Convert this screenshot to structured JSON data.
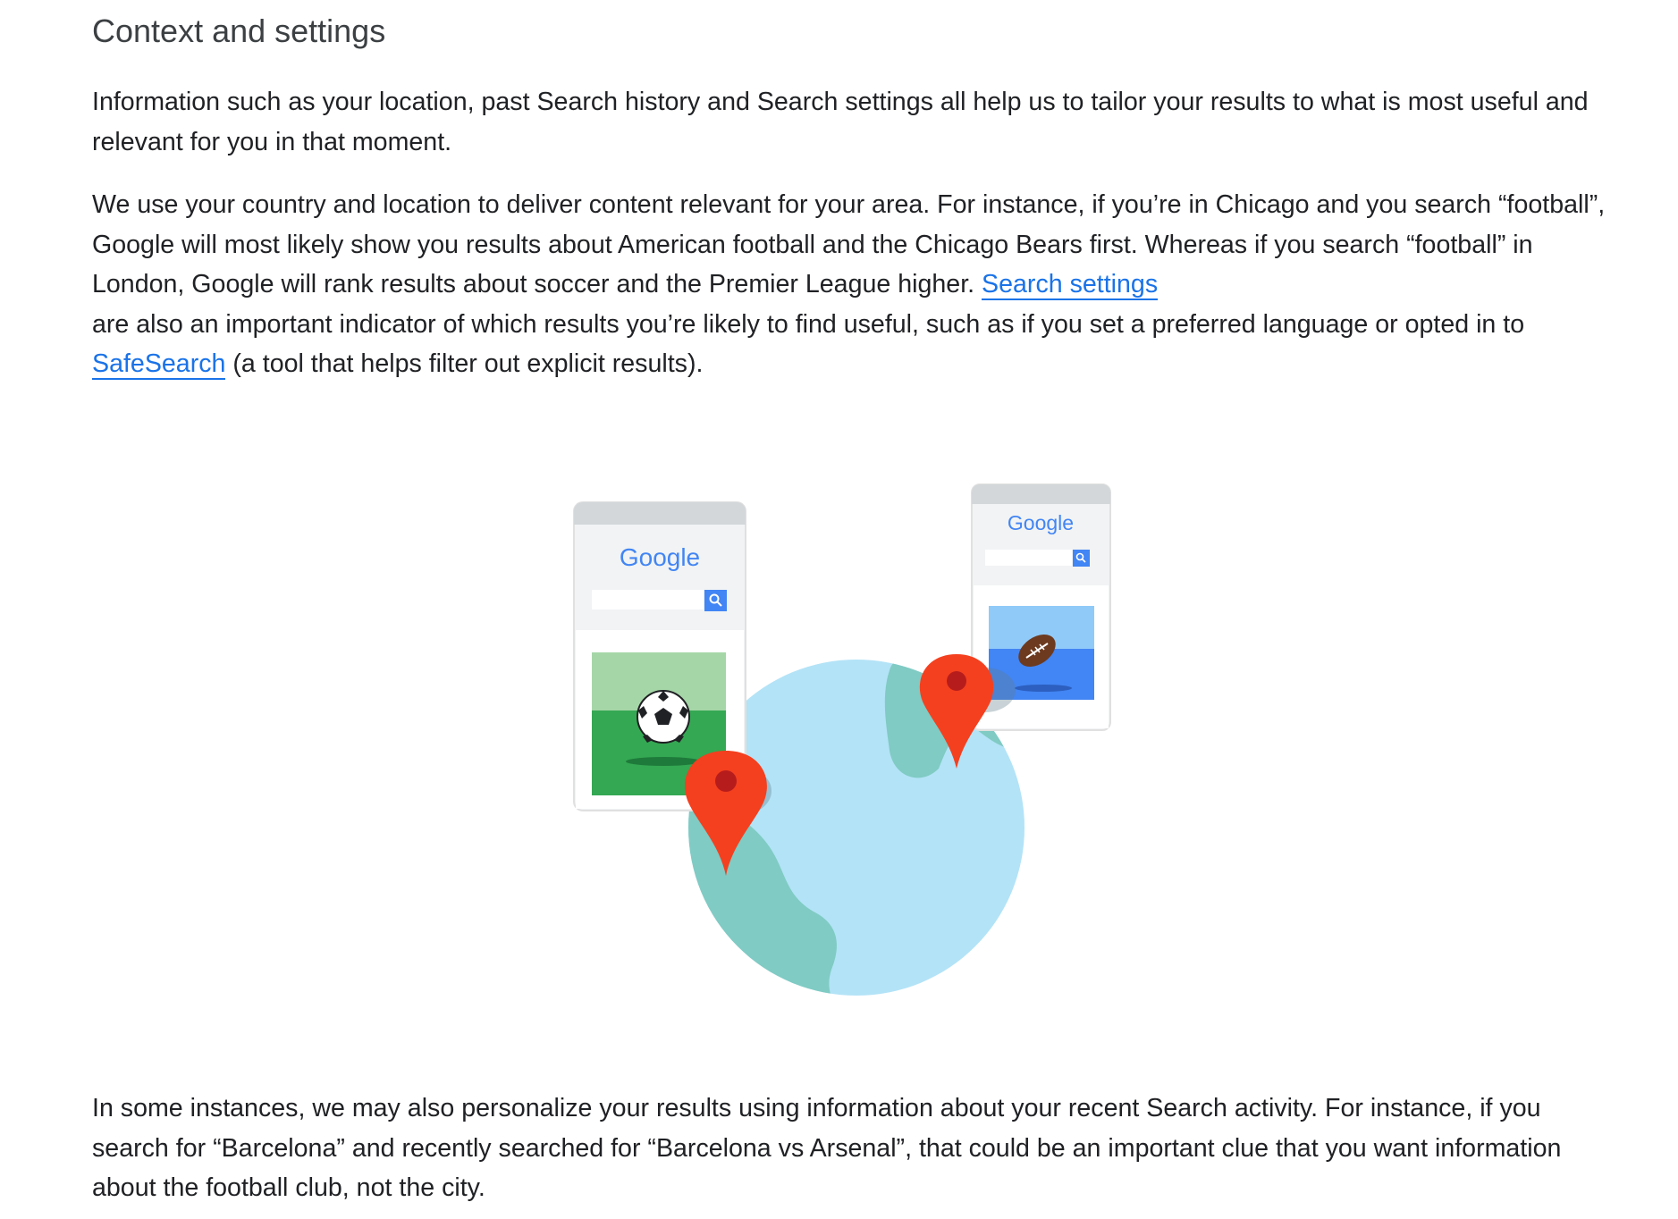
{
  "section": {
    "heading": "Context and settings"
  },
  "paragraph1": {
    "text": "Information such as your location, past Search history and Search settings all help us to tailor your results to what is most useful and relevant for you in that moment."
  },
  "paragraph2": {
    "text_part1": "We use your country and location to deliver content relevant for your area. For instance, if you’re in Chicago and you search “football”, Google will most likely show you results about American football and the Chicago Bears first. Whereas if you search “football” in London, Google will rank results about soccer and the Premier League higher.",
    "link_search_settings": "Search settings",
    "text_part2": "are also an important indicator of which results you’re likely to find useful, such as if you set a preferred language or opted in to",
    "link_safesearch": "SafeSearch",
    "text_part3": "(a tool that helps filter out explicit results)."
  },
  "illustration": {
    "phone_left_logo": "Google",
    "phone_right_logo": "Google",
    "icons": [
      "globe-icon",
      "location-pin-icon",
      "soccer-ball-icon",
      "american-football-icon",
      "search-icon"
    ],
    "colors": {
      "globe_ocean": "#b3e3f7",
      "globe_land": "#80cbc4",
      "pin": "#f4401f",
      "pin_dot": "#b71c1c",
      "soccer_field_light": "#a5d6a7",
      "soccer_field_dark": "#34a853",
      "football_sky": "#90caf9",
      "football_field": "#4285f4",
      "search_button": "#4285f4"
    }
  },
  "paragraph3": {
    "text": "In some instances, we may also personalize your results using information about your recent Search activity. For instance, if you search for “Barcelona” and recently searched for “Barcelona vs Arsenal”, that could be an important clue that you want information about the football club, not the city."
  }
}
